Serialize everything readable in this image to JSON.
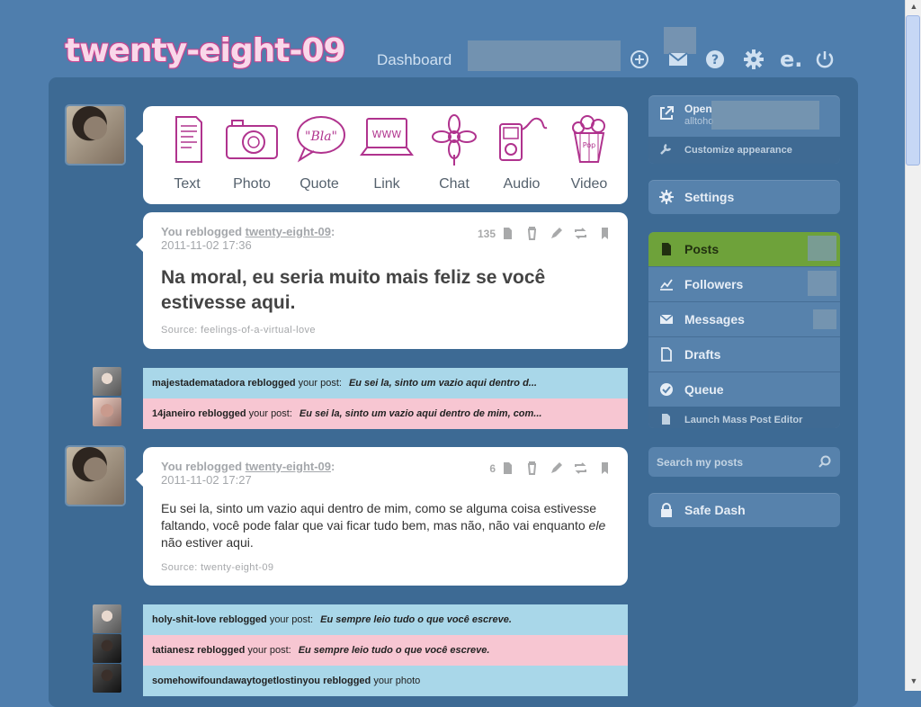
{
  "header": {
    "logo": "twenty-eight-09",
    "dashboard_link": "Dashboard",
    "icons": [
      "new-post-icon",
      "inbox-icon",
      "help-icon",
      "settings-icon",
      "extension-e-icon",
      "logout-icon"
    ]
  },
  "post_types": [
    "Text",
    "Photo",
    "Quote",
    "Link",
    "Chat",
    "Audio",
    "Video"
  ],
  "posts": [
    {
      "meta_prefix": "You reblogged",
      "author": "twenty-eight-09",
      "colon": ":",
      "timestamp": "2011-11-02 17:36",
      "notes_count": "135",
      "body": "Na moral, eu seria muito mais feliz se você estivesse aqui.",
      "source": "Source: feelings-of-a-virtual-love"
    },
    {
      "meta_prefix": "You reblogged",
      "author": "twenty-eight-09",
      "colon": ":",
      "timestamp": "2011-11-02 17:27",
      "notes_count": "6",
      "body_part1": "Eu sei la, sinto um vazio aqui dentro de mim, como se alguma coisa estivesse faltando, você pode falar que vai ficar tudo bem, mas não, não vai enquanto ",
      "body_em": "ele",
      "body_part2": " não estiver aqui.",
      "source": "Source: twenty-eight-09"
    }
  ],
  "notes_group_1": [
    {
      "user": "majestadematadora",
      "verb": "reblogged",
      "rest": "your post:",
      "quote": "Eu sei la, sinto um vazio aqui dentro d..."
    },
    {
      "user": "14janeiro",
      "verb": "reblogged",
      "rest": "your post:",
      "quote": "Eu sei la, sinto um vazio aqui dentro de mim, com..."
    }
  ],
  "notes_group_2": [
    {
      "user": "holy-shit-love",
      "verb": "reblogged",
      "rest": "your post:",
      "quote": "Eu sempre leio tudo o que você escreve."
    },
    {
      "user": "tatianesz",
      "verb": "reblogged",
      "rest": "your post:",
      "quote": "Eu sempre leio tudo o que você escreve."
    },
    {
      "user": "somehowifoundawaytogetlostinyou",
      "verb": "reblogged",
      "rest": "your photo",
      "quote": ""
    }
  ],
  "sidebar": {
    "open_label": "Open",
    "open_url_partial": "alltoho",
    "customize": "Customize appearance",
    "settings": "Settings",
    "nav": [
      "Posts",
      "Followers",
      "Messages",
      "Drafts",
      "Queue"
    ],
    "mass_editor": "Launch Mass Post Editor",
    "search_placeholder": "Search my posts",
    "safe_dash": "Safe Dash"
  },
  "colors": {
    "background": "#4f7ead",
    "panel": "#3d6a94",
    "active_nav": "#6ea23a",
    "note_blue": "#a9d7e9",
    "note_pink": "#f7c6d2",
    "logo_pink": "#d64f9d"
  }
}
